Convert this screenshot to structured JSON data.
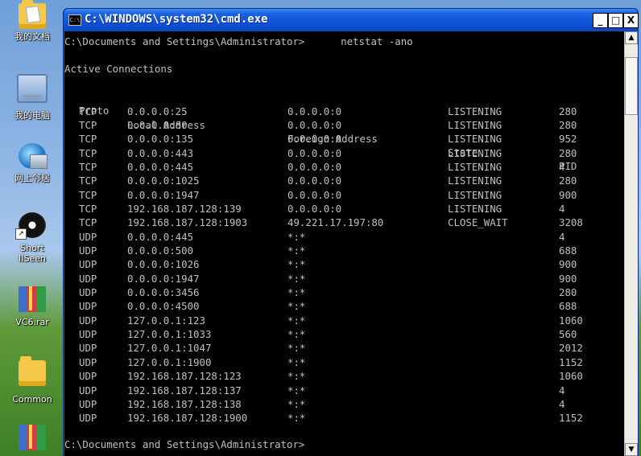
{
  "desktop": {
    "icons": [
      {
        "label": "我的文档",
        "icon": "my-documents-icon"
      },
      {
        "label": "我的电脑",
        "icon": "my-computer-icon"
      },
      {
        "label": "网上邻居",
        "icon": "network-places-icon"
      },
      {
        "label": "Short",
        "label2": "IISeen",
        "icon": "shortcut-disc-icon"
      },
      {
        "label": "VC6.rar",
        "icon": "rar-archive-icon"
      },
      {
        "label": "Common",
        "icon": "folder-icon"
      }
    ]
  },
  "window": {
    "title": "C:\\WINDOWS\\system32\\cmd.exe",
    "icon": "cmd-icon",
    "buttons": {
      "minimize": "_",
      "maximize": "□",
      "close": "X"
    }
  },
  "console": {
    "prompt_line": "C:\\Documents and Settings\\Administrator>      netstat -ano",
    "heading": "Active Connections",
    "headers": [
      "Proto",
      "Local Address",
      "Foreign Address",
      "State",
      "PID"
    ],
    "rows": [
      [
        "TCP",
        "0.0.0.0:25",
        "0.0.0.0:0",
        "LISTENING",
        "280"
      ],
      [
        "TCP",
        "0.0.0.0:80",
        "0.0.0.0:0",
        "LISTENING",
        "280"
      ],
      [
        "TCP",
        "0.0.0.0:135",
        "0.0.0.0:0",
        "LISTENING",
        "952"
      ],
      [
        "TCP",
        "0.0.0.0:443",
        "0.0.0.0:0",
        "LISTENING",
        "280"
      ],
      [
        "TCP",
        "0.0.0.0:445",
        "0.0.0.0:0",
        "LISTENING",
        "4"
      ],
      [
        "TCP",
        "0.0.0.0:1025",
        "0.0.0.0:0",
        "LISTENING",
        "280"
      ],
      [
        "TCP",
        "0.0.0.0:1947",
        "0.0.0.0:0",
        "LISTENING",
        "900"
      ],
      [
        "TCP",
        "192.168.187.128:139",
        "0.0.0.0:0",
        "LISTENING",
        "4"
      ],
      [
        "TCP",
        "192.168.187.128:1903",
        "49.221.17.197:80",
        "CLOSE_WAIT",
        "3208"
      ],
      [
        "UDP",
        "0.0.0.0:445",
        "*:*",
        "",
        "4"
      ],
      [
        "UDP",
        "0.0.0.0:500",
        "*:*",
        "",
        "688"
      ],
      [
        "UDP",
        "0.0.0.0:1026",
        "*:*",
        "",
        "900"
      ],
      [
        "UDP",
        "0.0.0.0:1947",
        "*:*",
        "",
        "900"
      ],
      [
        "UDP",
        "0.0.0.0:3456",
        "*:*",
        "",
        "280"
      ],
      [
        "UDP",
        "0.0.0.0:4500",
        "*:*",
        "",
        "688"
      ],
      [
        "UDP",
        "127.0.0.1:123",
        "*:*",
        "",
        "1060"
      ],
      [
        "UDP",
        "127.0.0.1:1033",
        "*:*",
        "",
        "560"
      ],
      [
        "UDP",
        "127.0.0.1:1047",
        "*:*",
        "",
        "2012"
      ],
      [
        "UDP",
        "127.0.0.1:1900",
        "*:*",
        "",
        "1152"
      ],
      [
        "UDP",
        "192.168.187.128:123",
        "*:*",
        "",
        "1060"
      ],
      [
        "UDP",
        "192.168.187.128:137",
        "*:*",
        "",
        "4"
      ],
      [
        "UDP",
        "192.168.187.128:138",
        "*:*",
        "",
        "4"
      ],
      [
        "UDP",
        "192.168.187.128:1900",
        "*:*",
        "",
        "1152"
      ]
    ],
    "final_prompt": "C:\\Documents and Settings\\Administrator>"
  },
  "scrollbar": {
    "up": "▲",
    "down": "▼"
  },
  "colors": {
    "console_bg": "#000000",
    "console_text": "#C0C0C0",
    "titlebar": "#0A54E0"
  }
}
